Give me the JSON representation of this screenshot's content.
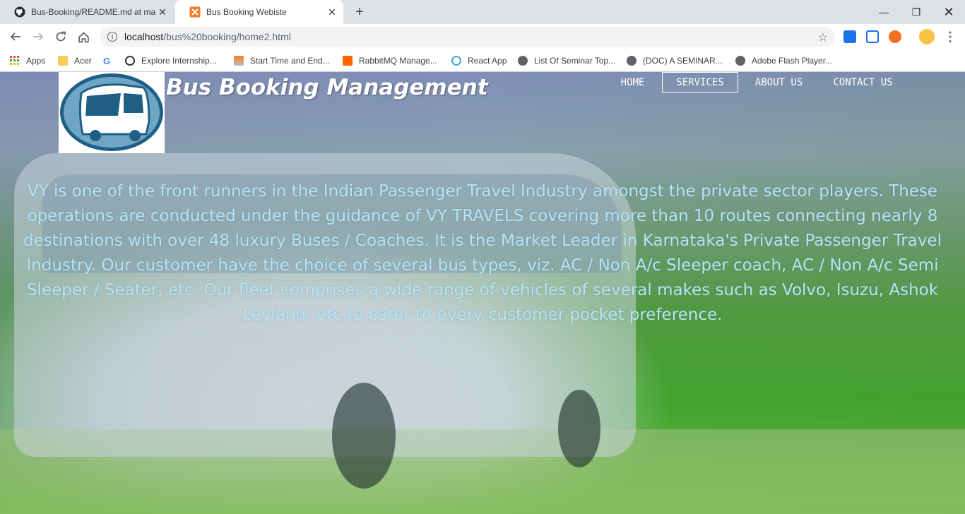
{
  "browser": {
    "tabs": [
      {
        "title": "Bus-Booking/README.md at ma",
        "icon": "github-icon",
        "active": false
      },
      {
        "title": "Bus Booking Webiste",
        "icon": "xampp-icon",
        "active": true
      }
    ],
    "address": {
      "host": "localhost",
      "path": "/bus%20booking/home2.html"
    },
    "bookmarks": [
      {
        "label": "Apps",
        "icon": "apps-grid-icon"
      },
      {
        "label": "Acer",
        "icon": "folder-icon"
      },
      {
        "label": "",
        "icon": "google-icon"
      },
      {
        "label": "Explore Internship...",
        "icon": "site-icon"
      },
      {
        "label": "Start Time and End...",
        "icon": "stack-icon"
      },
      {
        "label": "RabbitMQ Manage...",
        "icon": "rabbitmq-icon"
      },
      {
        "label": "React App",
        "icon": "react-icon"
      },
      {
        "label": "List Of Seminar Top...",
        "icon": "globe-icon"
      },
      {
        "label": "(DOC) A SEMINAR...",
        "icon": "globe-icon"
      },
      {
        "label": "Adobe Flash Player...",
        "icon": "globe-icon"
      }
    ]
  },
  "site": {
    "brand": "Bus Booking Management",
    "nav": [
      "HOME",
      "SERVICES",
      "ABOUT US",
      "CONTACT US"
    ],
    "active_nav": "SERVICES",
    "about": "VY is one of the front runners in the Indian Passenger Travel Industry amongst the private sector players. These operations are conducted under the guidance of VY TRAVELS covering more than 10 routes connecting nearly 8 destinations with over 48 luxury Buses / Coaches. It is the Market Leader in Karnataka's Private Passenger Travel Industry. Our customer have the choice of several bus types, viz. AC / Non A/c Sleeper coach, AC / Non A/c Semi Sleeper / Seater, etc. Our fleet comprises a wide range of vehicles of several makes such as Volvo, Isuzu, Ashok Leyland, etc to cater to every customer pocket preference.",
    "colors": {
      "about_text": "#b6e4f5",
      "logo_blue": "#1f5f85"
    }
  }
}
